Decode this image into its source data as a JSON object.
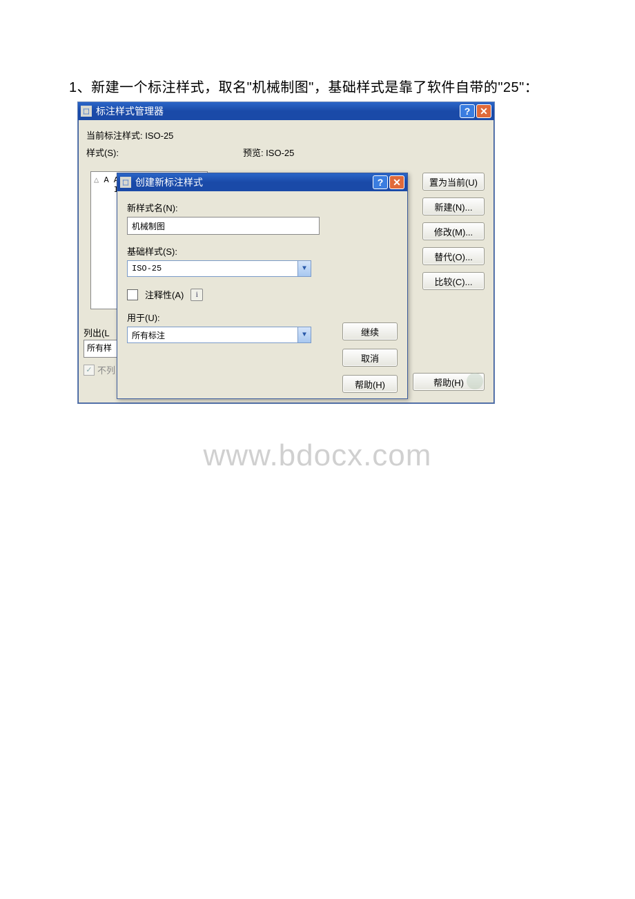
{
  "instruction": "1、新建一个标注样式，取名\"机械制图\"，基础样式是靠了软件自带的\"25\"：",
  "manager": {
    "title": "标注样式管理器",
    "current_label": "当前标注样式: ISO-25",
    "styles_label": "样式(S):",
    "preview_label": "预览: ISO-25",
    "list_items": [
      "A  Ar",
      "   IS"
    ],
    "list_label": "列出(L",
    "list_combo_value": "所有样",
    "no_list_label": "不列",
    "buttons": {
      "set_current": "置为当前(U)",
      "new": "新建(N)...",
      "modify": "修改(M)...",
      "override": "替代(O)...",
      "compare": "比较(C)...",
      "help": "帮助(H)"
    }
  },
  "new_style": {
    "title": "创建新标注样式",
    "name_label": "新样式名(N):",
    "name_value": "机械制图",
    "base_label": "基础样式(S):",
    "base_value": "ISO-25",
    "annotative_label": "注释性(A)",
    "use_for_label": "用于(U):",
    "use_for_value": "所有标注",
    "buttons": {
      "continue": "继续",
      "cancel": "取消",
      "help": "帮助(H)"
    }
  },
  "watermark": "www.bdocx.com"
}
